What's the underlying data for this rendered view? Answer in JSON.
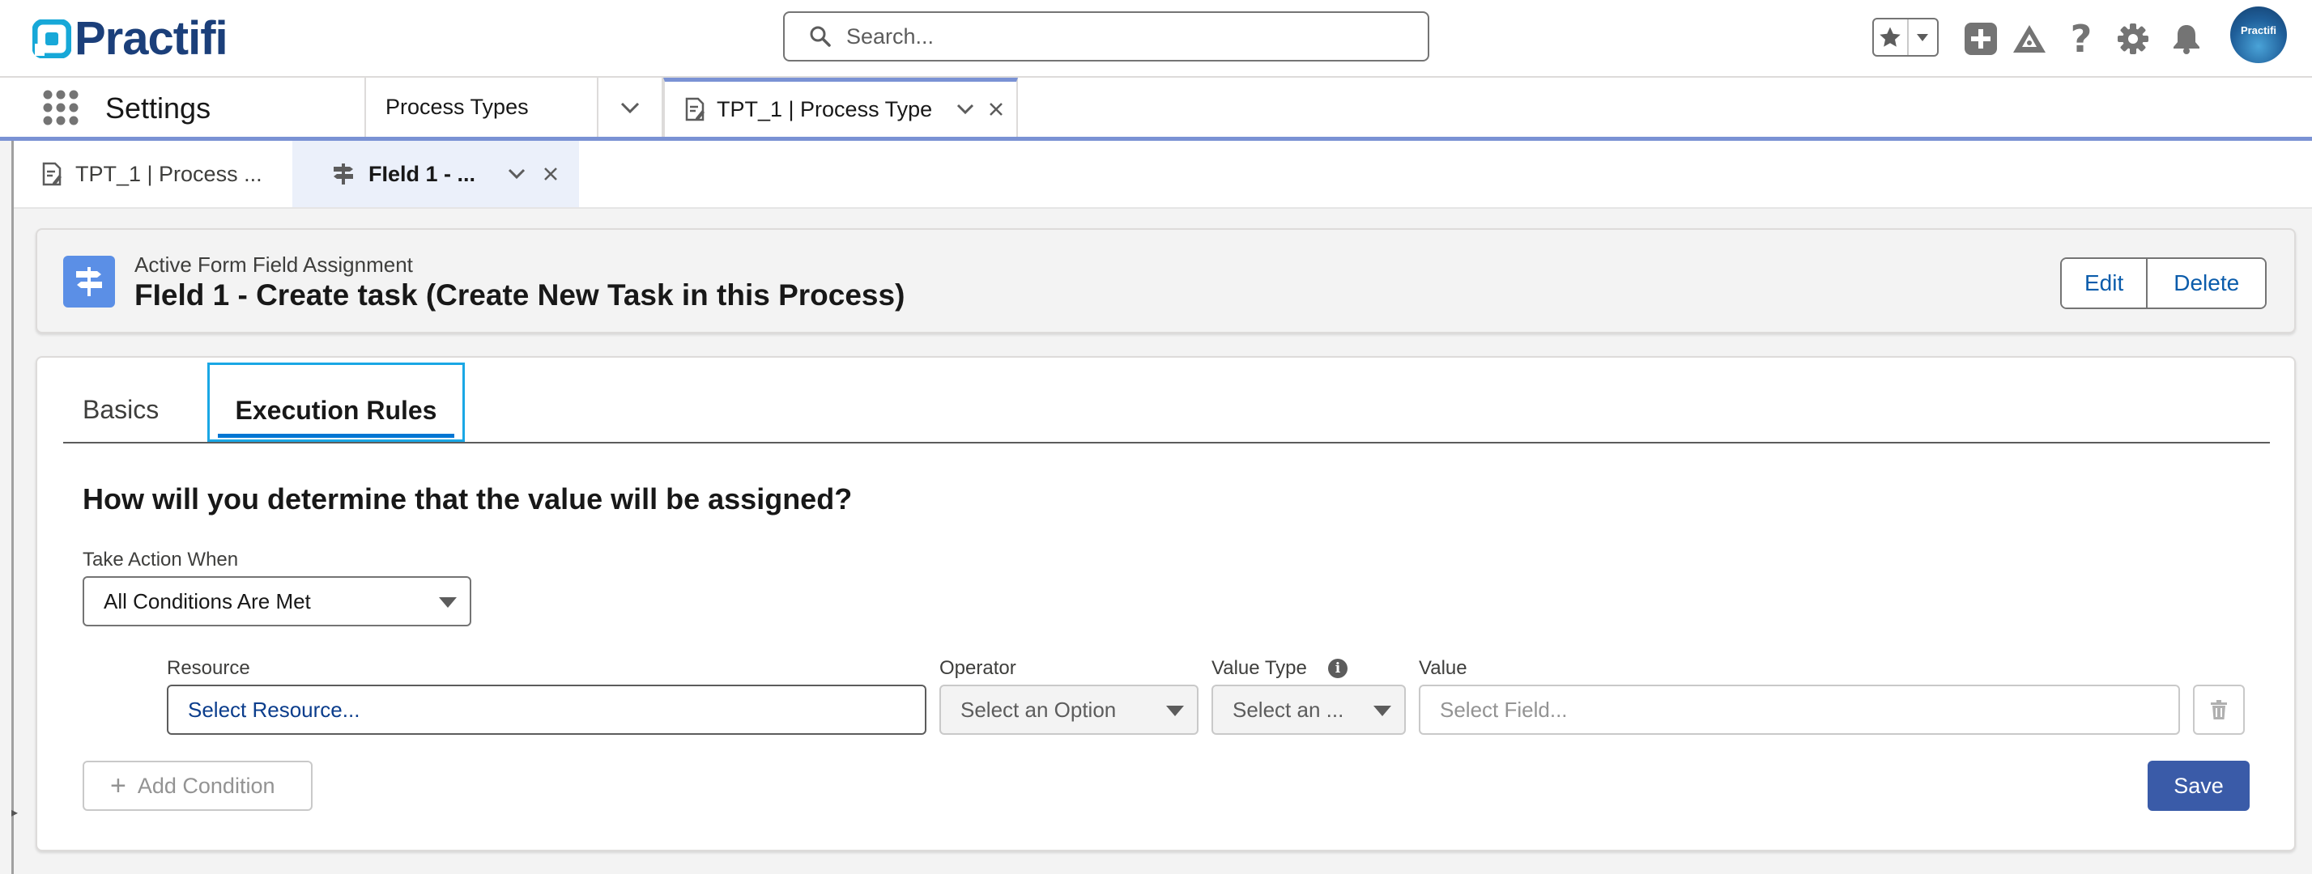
{
  "brand": {
    "name": "Practifi",
    "color": "#1b3f7a"
  },
  "search": {
    "placeholder": "Search..."
  },
  "header_icons": [
    "star-icon",
    "chevron-down-icon",
    "plus-icon",
    "trailhead-icon",
    "help-icon",
    "gear-icon",
    "bell-icon"
  ],
  "avatar": {
    "label": "Practifi"
  },
  "app_nav": {
    "app_name": "Settings",
    "items": [
      {
        "label": "Process Types"
      }
    ],
    "active_tab": {
      "label": "TPT_1 | Process Type"
    }
  },
  "subtabs": [
    {
      "label": "TPT_1 | Process ..."
    },
    {
      "label": "FIeld 1 - ..."
    }
  ],
  "record": {
    "type_label": "Active Form Field Assignment",
    "title": "FIeld 1 - Create task (Create New Task in this Process)",
    "actions": {
      "edit": "Edit",
      "delete": "Delete"
    }
  },
  "tabs": [
    {
      "label": "Basics"
    },
    {
      "label": "Execution Rules"
    }
  ],
  "rules": {
    "question": "How will you determine that the value will be assigned?",
    "take_action": {
      "label": "Take Action When",
      "value": "All Conditions Are Met"
    },
    "condition": {
      "resource": {
        "label": "Resource",
        "value": "Select Resource..."
      },
      "operator": {
        "label": "Operator",
        "value": "Select an Option"
      },
      "value_type": {
        "label": "Value Type",
        "value": "Select an ..."
      },
      "value": {
        "label": "Value",
        "placeholder": "Select Field..."
      }
    },
    "add_condition": "Add Condition",
    "save": "Save"
  },
  "colors": {
    "accent": "#0176d3",
    "save_button": "#3a5ba8",
    "tab_focus": "#1aa7e5",
    "record_icon": "#5b8fe6"
  }
}
